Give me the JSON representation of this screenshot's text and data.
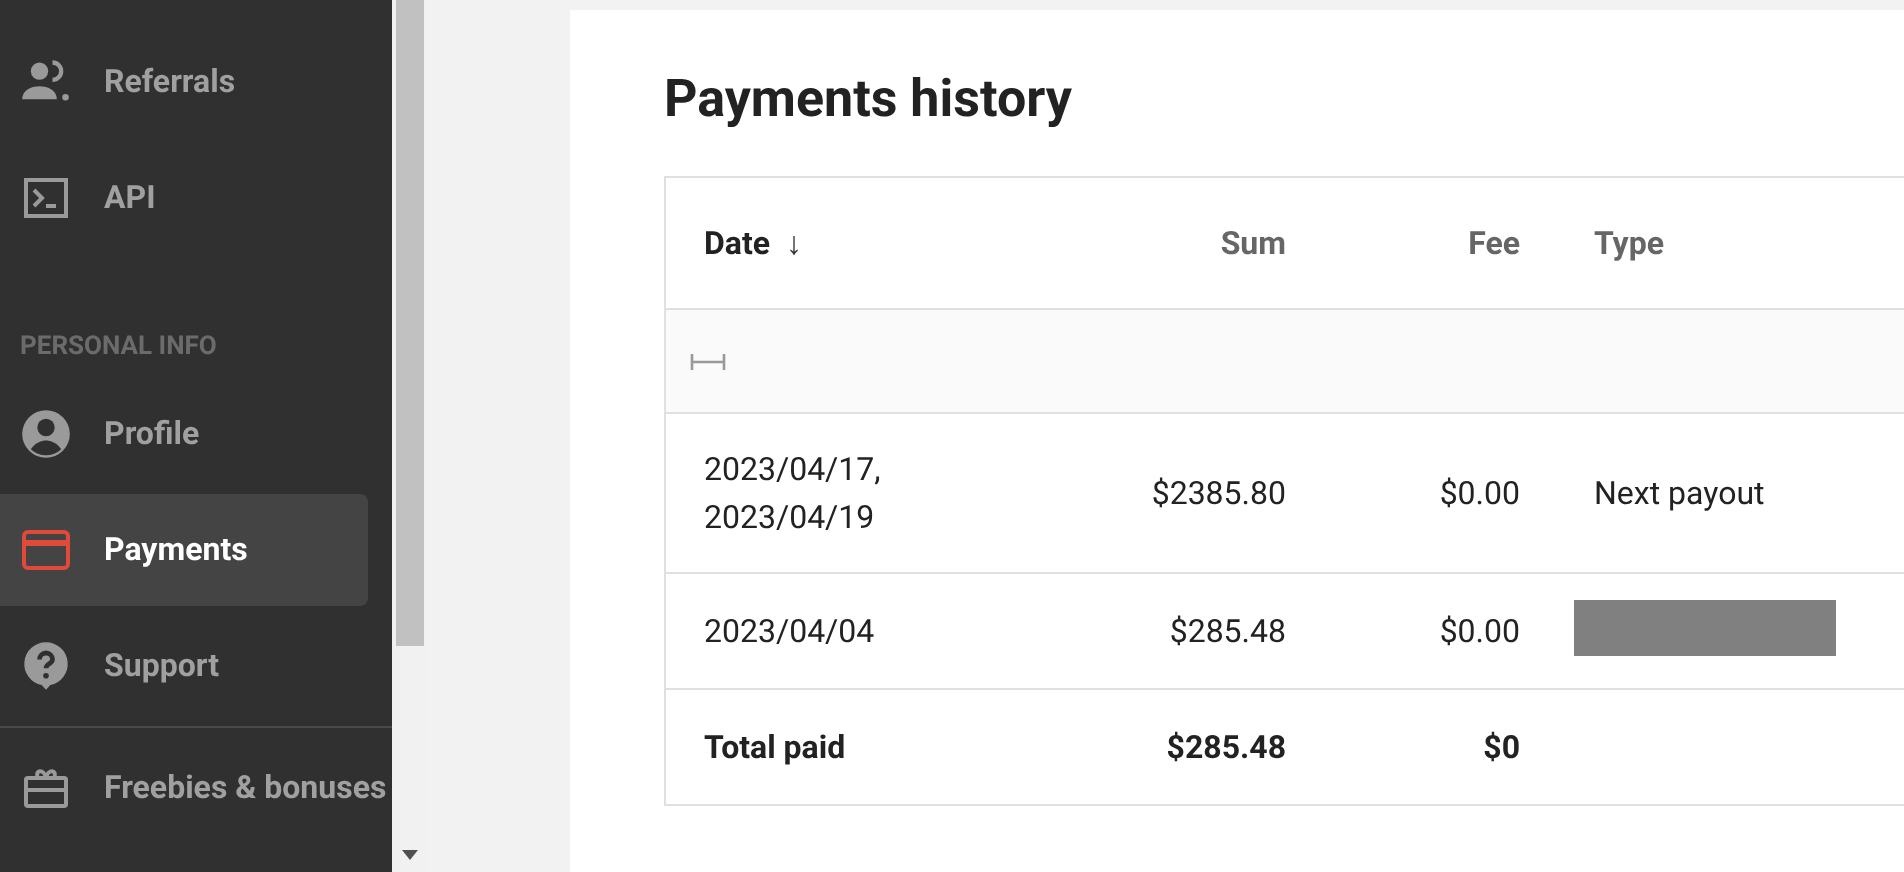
{
  "sidebar": {
    "items": [
      {
        "kind": "item",
        "label": "Referrals",
        "selected": false
      },
      {
        "kind": "item",
        "label": "API",
        "selected": false
      },
      {
        "kind": "header",
        "label": "PERSONAL INFO"
      },
      {
        "kind": "item",
        "label": "Profile",
        "selected": false
      },
      {
        "kind": "item",
        "label": "Payments",
        "selected": true
      },
      {
        "kind": "item",
        "label": "Support",
        "selected": false
      },
      {
        "kind": "divider"
      },
      {
        "kind": "item",
        "label": "Freebies & bonuses",
        "selected": false
      }
    ]
  },
  "page": {
    "title": "Payments history"
  },
  "table": {
    "columns": [
      {
        "label": "Date",
        "sort": "↓"
      },
      {
        "label": "Sum"
      },
      {
        "label": "Fee"
      },
      {
        "label": "Type"
      }
    ],
    "rows": [
      {
        "date": "2023/04/17,\n2023/04/19",
        "sum": "$2385.80",
        "fee": "$0.00",
        "type": "Next payout",
        "redacted": false
      },
      {
        "date": "2023/04/04",
        "sum": "$285.48",
        "fee": "$0.00",
        "redacted": true
      }
    ],
    "total": {
      "label": "Total paid",
      "sum": "$285.48",
      "fee": "$0"
    }
  }
}
